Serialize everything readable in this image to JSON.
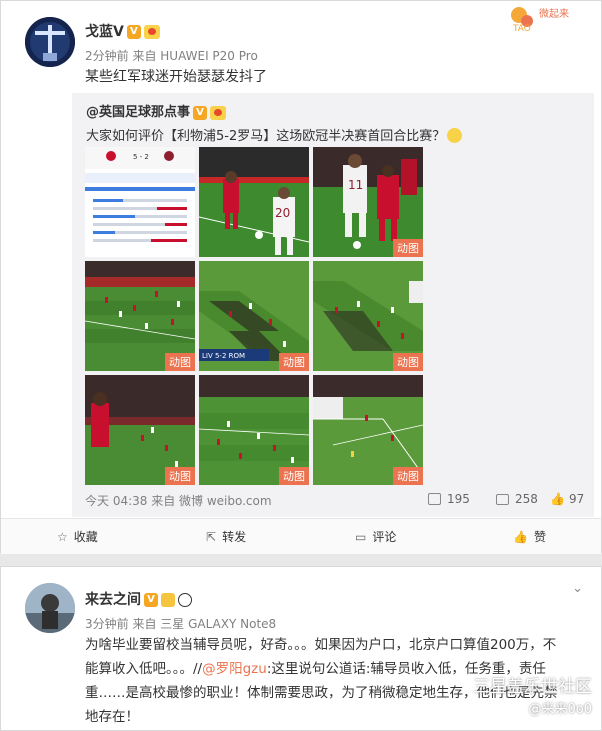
{
  "post1": {
    "user_name": "戈蓝V",
    "meta": "2分钟前 来自 HUAWEI P20 Pro",
    "text": "某些红军球迷开始瑟瑟发抖了",
    "logo_text": "微起来",
    "repost": {
      "author": "@英国足球那点事",
      "text_before": "大家如何评价【利物浦5-2罗马】这场欧冠半决赛首回合比赛？",
      "thumbnails": [
        {
          "type": "stats",
          "badge": ""
        },
        {
          "type": "play",
          "badge": ""
        },
        {
          "type": "play",
          "badge": "动图"
        },
        {
          "type": "field",
          "badge": "动图"
        },
        {
          "type": "field",
          "badge": "动图"
        },
        {
          "type": "field",
          "badge": "动图"
        },
        {
          "type": "field",
          "badge": "动图"
        },
        {
          "type": "field",
          "badge": "动图"
        },
        {
          "type": "field",
          "badge": "动图"
        }
      ],
      "stats_thumb": {
        "top_left": "LIVERPOOL",
        "bottom_label": "LIV 5-2 ROM"
      },
      "time_source": "今天 04:38 来自 微博 weibo.com",
      "shares": "195",
      "comments": "258",
      "likes": "97"
    },
    "actions": {
      "collect": "收藏",
      "forward": "转发",
      "comment": "评论",
      "like": "赞"
    }
  },
  "post2": {
    "user_name": "来去之间",
    "meta": "3分钟前 来自 三星 GALAXY Note8",
    "text_line1": "为啥毕业要留校当辅导员呢，好奇。。。如果因为户口，北京户口算值200万，不",
    "text_line2_a": "能算收入低吧。。。//",
    "text_line2_mention": "@罗阳gzu",
    "text_line2_b": ":这里说句公道话:辅导员收入低，任务重，责任",
    "text_line3": "重……是高校最惨的职业！体制需要思政，为了稍微稳定地生存，他们也是先禁",
    "text_line4": "地存在！"
  },
  "watermark": {
    "line1": "三星盖乐世社区",
    "line2": "@来来0o0"
  },
  "colors": {
    "accent": "#eb7350",
    "verified": "#f5a623",
    "repost_bg": "#f2f2f5"
  }
}
